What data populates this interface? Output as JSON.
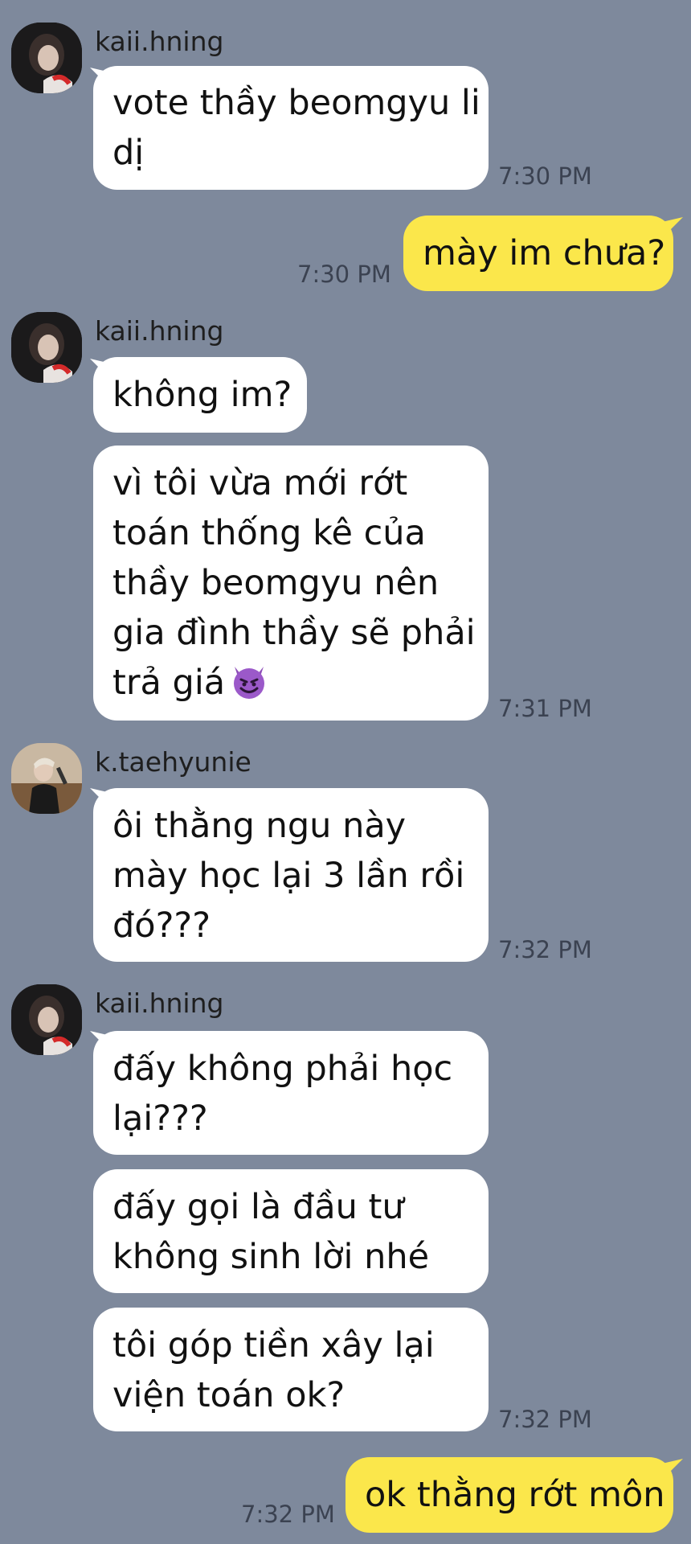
{
  "messages": [
    {
      "sender": "kaii.hning",
      "lines": [
        "vote thầy beomgyu li",
        "dị"
      ],
      "time": "7:30 PM"
    },
    {
      "sender": "me",
      "lines": [
        "mày im chưa?"
      ],
      "time": "7:30 PM"
    },
    {
      "sender": "kaii.hning",
      "lines": [
        "không im?"
      ]
    },
    {
      "sender": "kaii.hning",
      "lines": [
        "vì tôi vừa mới rớt",
        "toán thống kê của",
        "thầy beomgyu nên",
        "gia đình thầy sẽ phải",
        "trả giá"
      ],
      "emoji": "smiling-devil-emoji",
      "time": "7:31 PM"
    },
    {
      "sender": "k.taehyunie",
      "lines": [
        "ôi thằng ngu này",
        "mày học lại 3 lần rồi",
        "đó???"
      ],
      "time": "7:32 PM"
    },
    {
      "sender": "kaii.hning",
      "lines": [
        "đấy không phải học",
        "lại???"
      ]
    },
    {
      "sender": "kaii.hning",
      "lines": [
        "đấy gọi là đầu tư",
        "không sinh lời nhé"
      ]
    },
    {
      "sender": "kaii.hning",
      "lines": [
        "tôi góp tiền xây lại",
        "viện toán ok?"
      ],
      "time": "7:32 PM"
    },
    {
      "sender": "me",
      "lines": [
        "ok thằng rớt môn"
      ],
      "time": "7:32 PM"
    }
  ],
  "colors": {
    "background": "#7e899c",
    "incoming": "#ffffff",
    "outgoing": "#fbe74b"
  }
}
